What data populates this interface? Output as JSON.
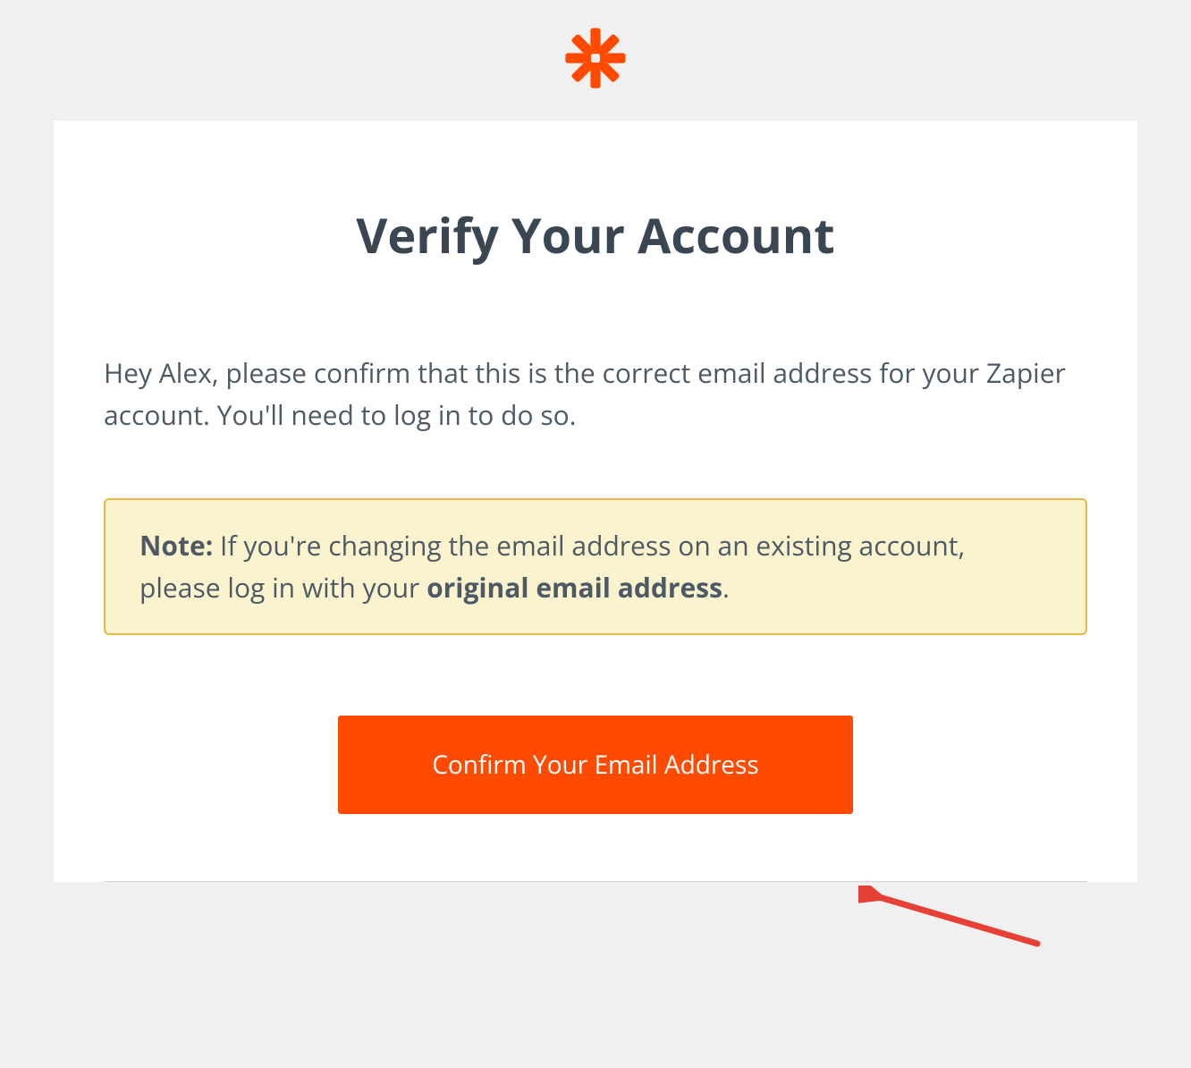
{
  "header": {
    "logo_name": "zapier-logo"
  },
  "content": {
    "title": "Verify Your Account",
    "intro": "Hey Alex, please confirm that this is the correct email address for your Zapier account. You'll need to log in to do so.",
    "note": {
      "label": "Note:",
      "text_before": " If you're changing the email address on an existing account, please log in with your ",
      "bold_phrase": "original email address",
      "text_after": "."
    },
    "button_label": "Confirm Your Email Address"
  },
  "colors": {
    "accent": "#ff4a00",
    "note_bg": "#fbf2ce",
    "note_border": "#e5b948",
    "text": "#4d5a66",
    "title": "#3a4752"
  }
}
